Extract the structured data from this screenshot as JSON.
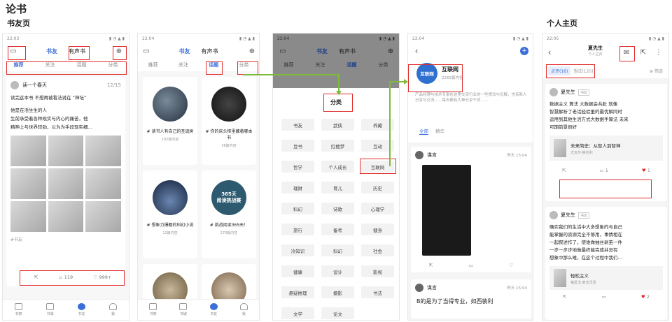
{
  "page": {
    "title": "论书",
    "section1": "书友页",
    "section2": "个人主页"
  },
  "status": {
    "time1": "22:03",
    "time2": "22:04",
    "time3": "22:04",
    "time4": "22:04",
    "time5": "22:05"
  },
  "header": {
    "tab_book_friend": "书友",
    "tab_audio_book": "有声书"
  },
  "tabs": {
    "recommend": "推荐",
    "follow": "关注",
    "topic": "话题",
    "category": "分类"
  },
  "screen1": {
    "post_user": "读一个春天",
    "post_time": "12/15",
    "post_text": [
      "读完这本书 不想再被看法说在 “神坛”",
      "他是在活生生的人",
      "生前承受着各种现实与内心的痛苦，他",
      "精神上与世界较劲，以为为手段现实细…"
    ],
    "tag": "#书友",
    "share_count": "",
    "comment_count": "119",
    "like_count": "999+"
  },
  "screen2": {
    "topics": [
      {
        "title": "# 读书人有自己的圣诞树",
        "meta": "192篇内容"
      },
      {
        "title": "# 你的床头柜里藏着哪本书",
        "meta": "56篇内容"
      },
      {
        "title": "# 想象力爆棚的科幻小说",
        "meta": "12篇内容"
      },
      {
        "title": "# 挑战阅读365天！",
        "meta": "270篇内容"
      }
    ],
    "badge": "365天\n阅读挑战赛"
  },
  "screen3": {
    "panel_title": "分类",
    "categories": [
      "书友",
      "武侠",
      "养藏",
      "豆书",
      "红楼梦",
      "互动",
      "哲学",
      "个人成长",
      "互联网",
      "理财",
      "育儿",
      "历史",
      "科幻",
      "诗歌",
      "心理学",
      "旅行",
      "备考",
      "健身",
      "冷知识",
      "科幻",
      "社会",
      "健康",
      "设计",
      "影视",
      "悬疑推理",
      "摄影",
      "书法",
      "文学",
      "论文",
      ""
    ]
  },
  "screen4": {
    "group_name": "互联网",
    "group_logo": "互联网",
    "group_meta": "2265篇内容",
    "group_desc": "产品经理与技术专家在这里交流行业的一些想法与见解，也有新人分享与交流……每天都有大神分享干货……",
    "tab_all": "全部",
    "tab_essence": "精华",
    "user1": "谋言",
    "user1_time": "昨天 15:04",
    "user2": "谋言",
    "user2_time": "昨天 15:04",
    "post2_text": "B的是为了当得专业，如西装利"
  },
  "screen5": {
    "user_name": "夏先生",
    "user_sub": "个人主页",
    "tab_reviews": "点评(16)",
    "tab_notes": "想法(120)",
    "filter": "筛选",
    "post1_user": "夏先生",
    "post1_tag": "书友",
    "post1_text": [
      "数据主义 算法 大数据会共赴 就像",
      "智慧解析了老话经验里的最优解同时",
      "运用到其他生活方式大数据手算法 未来",
      "可期前景很好"
    ],
    "book_title": "未来简史：从智人到智神",
    "book_author": "尤瓦尔·赫拉利",
    "comment_count": "1",
    "like_count": "1",
    "post2_user": "夏先生",
    "post2_tag": "书友",
    "post2_text": [
      "确实我们的生活中大多想象的与自己",
      "能掌握的资源完全不够用，事情相在",
      "一起叙述作了，使谁做抽丝剥茧一件",
      "一步一步步地做最终能完成并没有",
      "想象中那么难，在这个过程中我们…"
    ],
    "book2_title": "轻松主义",
    "book2_author": "格雷戈·麦吉沃恩",
    "like2_count": "2"
  },
  "nav": {
    "item1": "书架",
    "item2": "书城",
    "item3": "书友",
    "item4": "我"
  },
  "colors": {
    "accent": "#3d6fd8",
    "highlight": "#e02b2b",
    "arrow": "#7dbb3a"
  }
}
